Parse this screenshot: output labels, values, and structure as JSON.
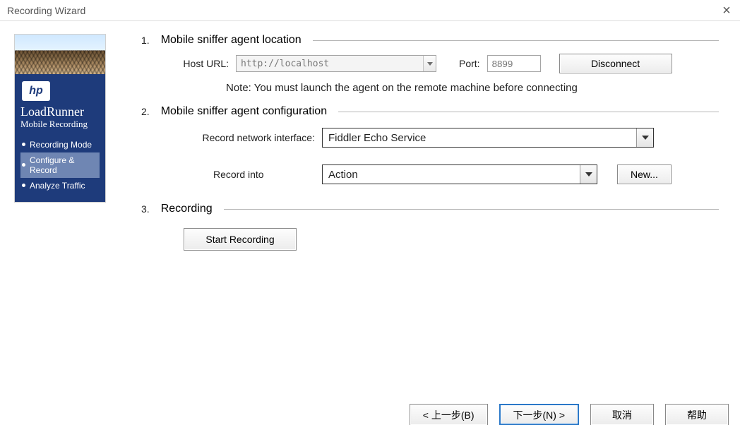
{
  "window": {
    "title": "Recording Wizard",
    "close": "×"
  },
  "sidebar": {
    "product": "LoadRunner",
    "subtitle": "Mobile Recording",
    "logo_text": "hp",
    "items": [
      {
        "label": "Recording Mode",
        "active": false
      },
      {
        "label": "Configure & Record",
        "active": true
      },
      {
        "label": "Analyze Traffic",
        "active": false
      }
    ]
  },
  "sections": {
    "s1": {
      "num": "1.",
      "title": "Mobile sniffer agent location",
      "host_label": "Host URL:",
      "host_value": "http://localhost",
      "port_label": "Port:",
      "port_value": "8899",
      "disconnect": "Disconnect",
      "note": "Note: You must launch the agent on the remote machine before connecting"
    },
    "s2": {
      "num": "2.",
      "title": "Mobile sniffer agent configuration",
      "iface_label": "Record network interface:",
      "iface_value": "Fiddler Echo Service",
      "into_label": "Record into",
      "into_value": "Action",
      "new_btn": "New..."
    },
    "s3": {
      "num": "3.",
      "title": "Recording",
      "start_btn": "Start Recording"
    }
  },
  "footer": {
    "back": "< 上一步(B)",
    "next": "下一步(N) >",
    "cancel": "取消",
    "help": "帮助"
  }
}
